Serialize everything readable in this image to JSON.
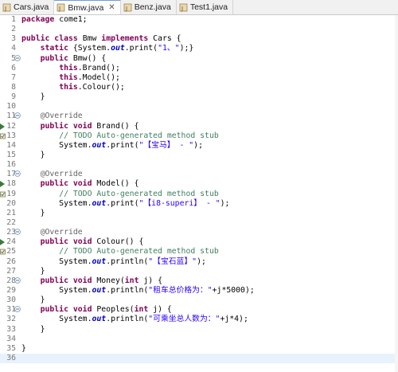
{
  "tabs": [
    {
      "label": "Cars.java",
      "active": false
    },
    {
      "label": "Bmw.java",
      "active": true
    },
    {
      "label": "Benz.java",
      "active": false
    },
    {
      "label": "Test1.java",
      "active": false
    }
  ],
  "close_glyph": "✕",
  "lines": [
    {
      "n": "1",
      "tokens": [
        {
          "t": "package",
          "c": "kw"
        },
        {
          "t": " come1;"
        }
      ]
    },
    {
      "n": "2",
      "tokens": []
    },
    {
      "n": "3",
      "tokens": [
        {
          "t": "public",
          "c": "kw"
        },
        {
          "t": " "
        },
        {
          "t": "class",
          "c": "kw"
        },
        {
          "t": " Bmw "
        },
        {
          "t": "implements",
          "c": "kw"
        },
        {
          "t": " Cars {"
        }
      ]
    },
    {
      "n": "4",
      "tokens": [
        {
          "t": "    "
        },
        {
          "t": "static",
          "c": "kw"
        },
        {
          "t": " {System."
        },
        {
          "t": "out",
          "c": "fld"
        },
        {
          "t": ".print("
        },
        {
          "t": "\"1、\"",
          "c": "st"
        },
        {
          "t": ");}"
        }
      ]
    },
    {
      "n": "5",
      "fold": true,
      "tokens": [
        {
          "t": "    "
        },
        {
          "t": "public",
          "c": "kw"
        },
        {
          "t": " Bmw() {"
        }
      ]
    },
    {
      "n": "6",
      "tokens": [
        {
          "t": "        "
        },
        {
          "t": "this",
          "c": "kw"
        },
        {
          "t": ".Brand();"
        }
      ]
    },
    {
      "n": "7",
      "tokens": [
        {
          "t": "        "
        },
        {
          "t": "this",
          "c": "kw"
        },
        {
          "t": ".Model();"
        }
      ]
    },
    {
      "n": "8",
      "tokens": [
        {
          "t": "        "
        },
        {
          "t": "this",
          "c": "kw"
        },
        {
          "t": ".Colour();"
        }
      ]
    },
    {
      "n": "9",
      "tokens": [
        {
          "t": "    }"
        }
      ]
    },
    {
      "n": "10",
      "tokens": []
    },
    {
      "n": "11",
      "fold": true,
      "tokens": [
        {
          "t": "    "
        },
        {
          "t": "@Override",
          "c": "ann"
        }
      ]
    },
    {
      "n": "12",
      "mark": true,
      "tokens": [
        {
          "t": "    "
        },
        {
          "t": "public",
          "c": "kw"
        },
        {
          "t": " "
        },
        {
          "t": "void",
          "c": "kw"
        },
        {
          "t": " Brand() {"
        }
      ]
    },
    {
      "n": "13",
      "task": true,
      "tokens": [
        {
          "t": "        "
        },
        {
          "t": "// ",
          "c": "cm"
        },
        {
          "t": "TODO",
          "c": "cm"
        },
        {
          "t": " Auto-generated method stub",
          "c": "cm"
        }
      ]
    },
    {
      "n": "14",
      "tokens": [
        {
          "t": "        System."
        },
        {
          "t": "out",
          "c": "fld"
        },
        {
          "t": ".print("
        },
        {
          "t": "\"【宝马】 - \"",
          "c": "st"
        },
        {
          "t": ");"
        }
      ]
    },
    {
      "n": "15",
      "tokens": [
        {
          "t": "    }"
        }
      ]
    },
    {
      "n": "16",
      "tokens": []
    },
    {
      "n": "17",
      "fold": true,
      "tokens": [
        {
          "t": "    "
        },
        {
          "t": "@Override",
          "c": "ann"
        }
      ]
    },
    {
      "n": "18",
      "mark": true,
      "tokens": [
        {
          "t": "    "
        },
        {
          "t": "public",
          "c": "kw"
        },
        {
          "t": " "
        },
        {
          "t": "void",
          "c": "kw"
        },
        {
          "t": " Model() {"
        }
      ]
    },
    {
      "n": "19",
      "task": true,
      "tokens": [
        {
          "t": "        "
        },
        {
          "t": "// ",
          "c": "cm"
        },
        {
          "t": "TODO",
          "c": "cm"
        },
        {
          "t": " Auto-generated method stub",
          "c": "cm"
        }
      ]
    },
    {
      "n": "20",
      "tokens": [
        {
          "t": "        System."
        },
        {
          "t": "out",
          "c": "fld"
        },
        {
          "t": ".print("
        },
        {
          "t": "\"【i8-superi】 - \"",
          "c": "st"
        },
        {
          "t": ");"
        }
      ]
    },
    {
      "n": "21",
      "tokens": [
        {
          "t": "    }"
        }
      ]
    },
    {
      "n": "22",
      "tokens": []
    },
    {
      "n": "23",
      "fold": true,
      "tokens": [
        {
          "t": "    "
        },
        {
          "t": "@Override",
          "c": "ann"
        }
      ]
    },
    {
      "n": "24",
      "mark": true,
      "tokens": [
        {
          "t": "    "
        },
        {
          "t": "public",
          "c": "kw"
        },
        {
          "t": " "
        },
        {
          "t": "void",
          "c": "kw"
        },
        {
          "t": " Colour() {"
        }
      ]
    },
    {
      "n": "25",
      "task": true,
      "tokens": [
        {
          "t": "        "
        },
        {
          "t": "// ",
          "c": "cm"
        },
        {
          "t": "TODO",
          "c": "cm"
        },
        {
          "t": " Auto-generated method stub",
          "c": "cm"
        }
      ]
    },
    {
      "n": "26",
      "tokens": [
        {
          "t": "        System."
        },
        {
          "t": "out",
          "c": "fld"
        },
        {
          "t": ".println("
        },
        {
          "t": "\"【宝石蓝】\"",
          "c": "st"
        },
        {
          "t": ");"
        }
      ]
    },
    {
      "n": "27",
      "tokens": [
        {
          "t": "    }"
        }
      ]
    },
    {
      "n": "28",
      "fold": true,
      "tokens": [
        {
          "t": "    "
        },
        {
          "t": "public",
          "c": "kw"
        },
        {
          "t": " "
        },
        {
          "t": "void",
          "c": "kw"
        },
        {
          "t": " Money("
        },
        {
          "t": "int",
          "c": "kw"
        },
        {
          "t": " j) {"
        }
      ]
    },
    {
      "n": "29",
      "tokens": [
        {
          "t": "        System."
        },
        {
          "t": "out",
          "c": "fld"
        },
        {
          "t": ".println("
        },
        {
          "t": "\"租车总价格为：\"",
          "c": "st"
        },
        {
          "t": "+j*5000);"
        }
      ]
    },
    {
      "n": "30",
      "tokens": [
        {
          "t": "    }"
        }
      ]
    },
    {
      "n": "31",
      "fold": true,
      "tokens": [
        {
          "t": "    "
        },
        {
          "t": "public",
          "c": "kw"
        },
        {
          "t": " "
        },
        {
          "t": "void",
          "c": "kw"
        },
        {
          "t": " Peoples("
        },
        {
          "t": "int",
          "c": "kw"
        },
        {
          "t": " j) {"
        }
      ]
    },
    {
      "n": "32",
      "tokens": [
        {
          "t": "        System."
        },
        {
          "t": "out",
          "c": "fld"
        },
        {
          "t": ".println("
        },
        {
          "t": "\"可乘坐总人数为：\"",
          "c": "st"
        },
        {
          "t": "+j*4);"
        }
      ]
    },
    {
      "n": "33",
      "tokens": [
        {
          "t": "    }"
        }
      ]
    },
    {
      "n": "34",
      "tokens": []
    },
    {
      "n": "35",
      "tokens": [
        {
          "t": "}"
        }
      ]
    },
    {
      "n": "36",
      "current": true,
      "tokens": []
    }
  ]
}
